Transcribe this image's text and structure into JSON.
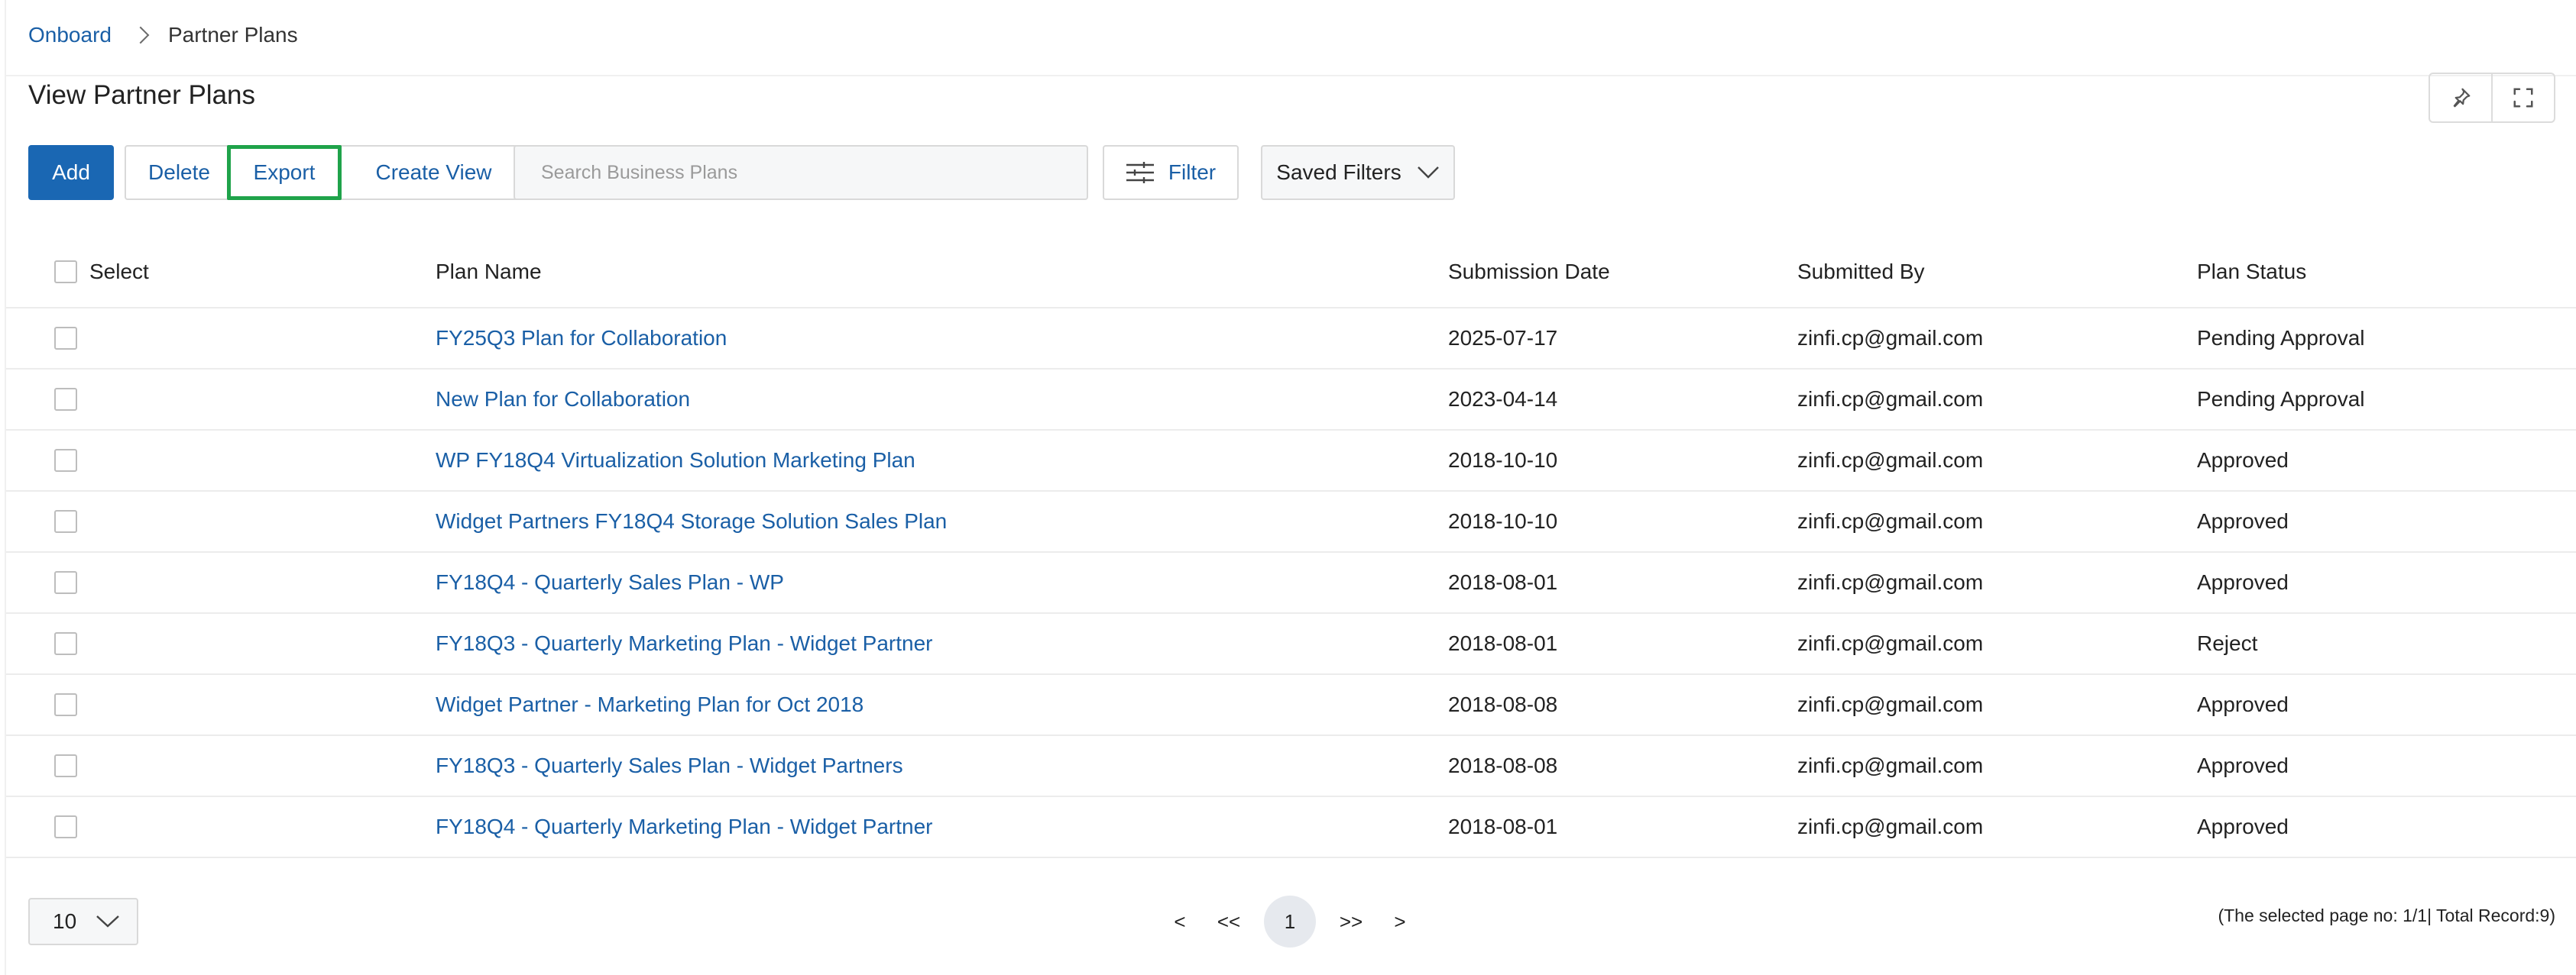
{
  "breadcrumb": {
    "parent": "Onboard",
    "current": "Partner Plans"
  },
  "page": {
    "title": "View Partner Plans"
  },
  "toolbar": {
    "add_label": "Add",
    "delete_label": "Delete",
    "export_label": "Export",
    "create_view_label": "Create View",
    "search_placeholder": "Search Business Plans",
    "search_value": "",
    "filter_label": "Filter",
    "saved_filters_label": "Saved Filters"
  },
  "icons": {
    "pin": "pin-icon",
    "fullscreen": "fullscreen-icon",
    "filter": "sliders-icon",
    "dropdown": "chevron-down-icon",
    "breadcrumb_separator": "chevron-right-icon"
  },
  "colors": {
    "primary": "#1a67b3",
    "link": "#1a5fa6",
    "highlight": "#1fa34a"
  },
  "table": {
    "columns": {
      "select": "Select",
      "plan_name": "Plan Name",
      "submission_date": "Submission Date",
      "submitted_by": "Submitted By",
      "plan_status": "Plan Status"
    },
    "rows": [
      {
        "plan_name": "FY25Q3 Plan for Collaboration",
        "submission_date": "2025-07-17",
        "submitted_by": "zinfi.cp@gmail.com",
        "plan_status": "Pending Approval"
      },
      {
        "plan_name": "New Plan for Collaboration",
        "submission_date": "2023-04-14",
        "submitted_by": "zinfi.cp@gmail.com",
        "plan_status": "Pending Approval"
      },
      {
        "plan_name": "WP FY18Q4 Virtualization Solution Marketing Plan",
        "submission_date": "2018-10-10",
        "submitted_by": "zinfi.cp@gmail.com",
        "plan_status": "Approved"
      },
      {
        "plan_name": "Widget Partners FY18Q4 Storage Solution Sales Plan",
        "submission_date": "2018-10-10",
        "submitted_by": "zinfi.cp@gmail.com",
        "plan_status": "Approved"
      },
      {
        "plan_name": "FY18Q4 - Quarterly Sales Plan - WP",
        "submission_date": "2018-08-01",
        "submitted_by": "zinfi.cp@gmail.com",
        "plan_status": "Approved"
      },
      {
        "plan_name": "FY18Q3 - Quarterly Marketing Plan - Widget Partner",
        "submission_date": "2018-08-01",
        "submitted_by": "zinfi.cp@gmail.com",
        "plan_status": "Reject"
      },
      {
        "plan_name": "Widget Partner - Marketing Plan for Oct 2018",
        "submission_date": "2018-08-08",
        "submitted_by": "zinfi.cp@gmail.com",
        "plan_status": "Approved"
      },
      {
        "plan_name": "FY18Q3 - Quarterly Sales Plan - Widget Partners",
        "submission_date": "2018-08-08",
        "submitted_by": "zinfi.cp@gmail.com",
        "plan_status": "Approved"
      },
      {
        "plan_name": "FY18Q4 - Quarterly Marketing Plan - Widget Partner",
        "submission_date": "2018-08-01",
        "submitted_by": "zinfi.cp@gmail.com",
        "plan_status": "Approved"
      }
    ]
  },
  "pagination": {
    "page_size": "10",
    "prev": "<",
    "first": "<<",
    "current_page": "1",
    "last": ">>",
    "next": ">",
    "info": "(The selected page no: 1/1| Total Record:9)"
  }
}
